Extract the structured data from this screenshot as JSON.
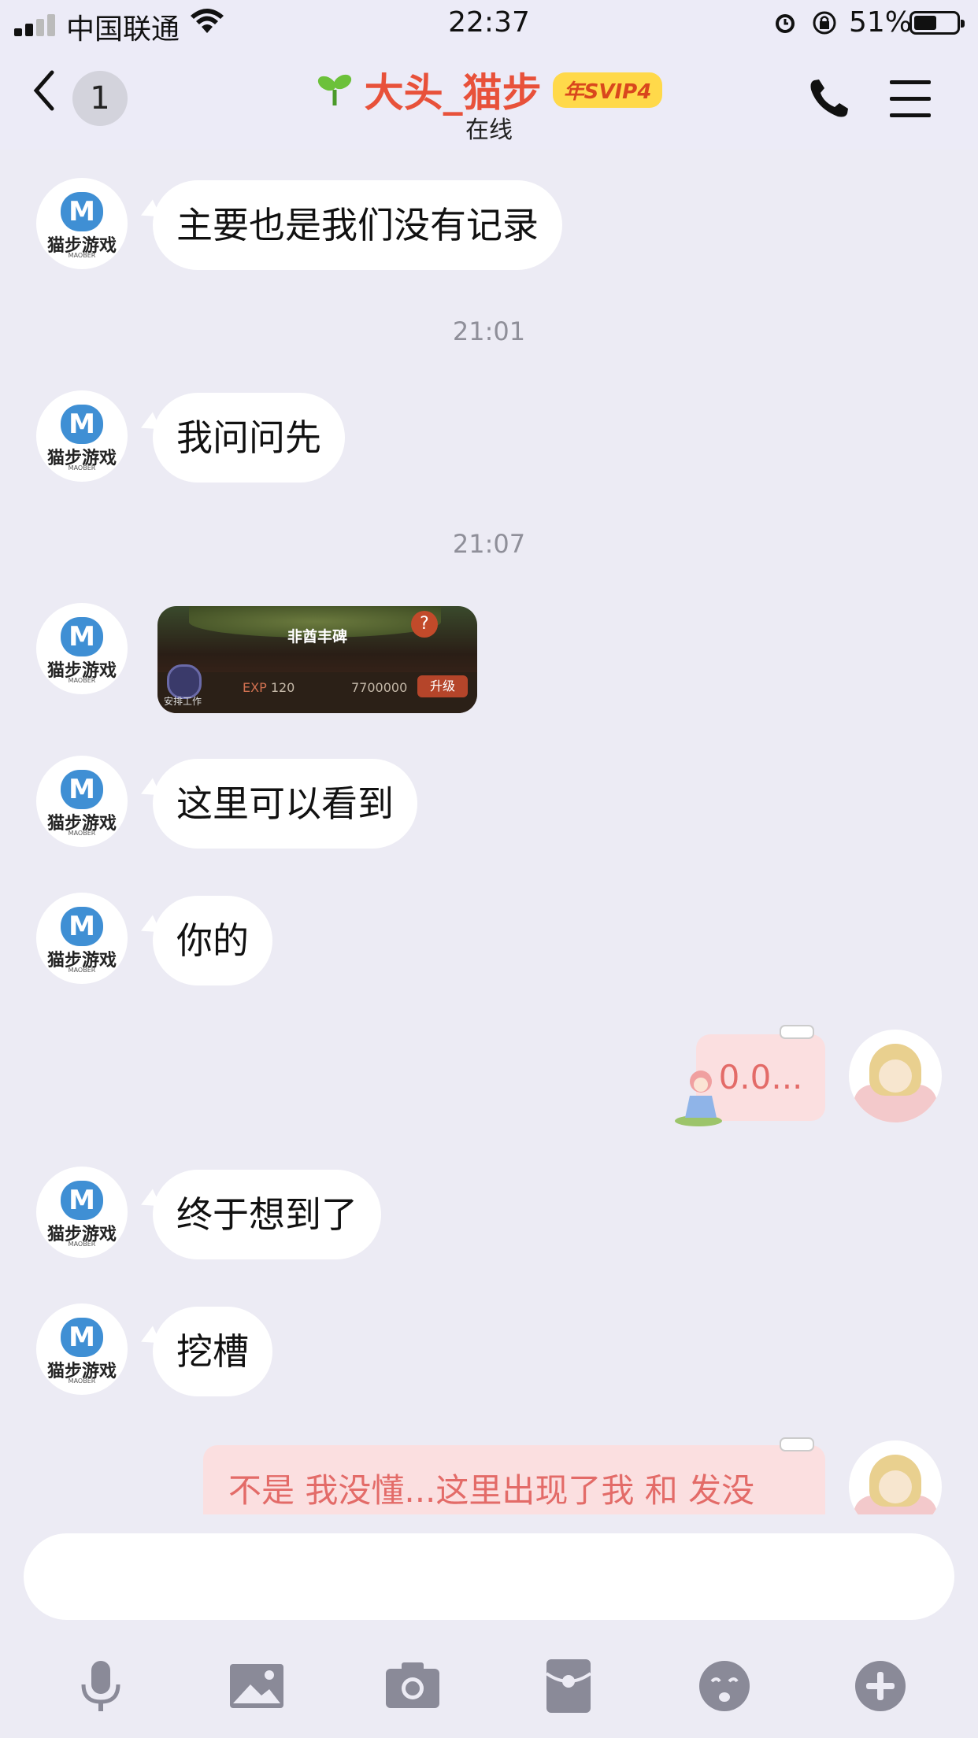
{
  "status_bar": {
    "carrier": "中国联通",
    "time": "22:37",
    "battery": "51%",
    "icons": [
      "signal-icon",
      "wifi-icon",
      "alarm-icon",
      "rotation-lock-icon",
      "battery-icon"
    ]
  },
  "header": {
    "unread_count": "1",
    "title": "大头_猫步",
    "badge": "年SVIP4",
    "status": "在线",
    "title_color": "#e8513a",
    "badge_color": "#ffd94a"
  },
  "messages": {
    "m1": "主要也是我们没有记录",
    "t1": "21:01",
    "m2": "我问问先",
    "t2": "21:07",
    "image": {
      "title": "非酋丰碑",
      "exp_label": "EXP",
      "exp_value": "120",
      "coins": "7700000",
      "upgrade": "升级",
      "work": "安排工作"
    },
    "m3": "这里可以看到",
    "m4": "你的",
    "my1": "0.0...",
    "m5": "终于想到了",
    "m6": "挖槽",
    "my2": "不是 我没懂...这里出现了我 和 发没"
  },
  "avatars": {
    "contact_brand": "猫步游戏",
    "contact_sub": "MAOBER",
    "contact_logo": "M"
  },
  "toolbar": {
    "items": [
      "microphone-icon",
      "image-icon",
      "camera-icon",
      "red-packet-icon",
      "emoji-icon",
      "plus-icon"
    ]
  }
}
